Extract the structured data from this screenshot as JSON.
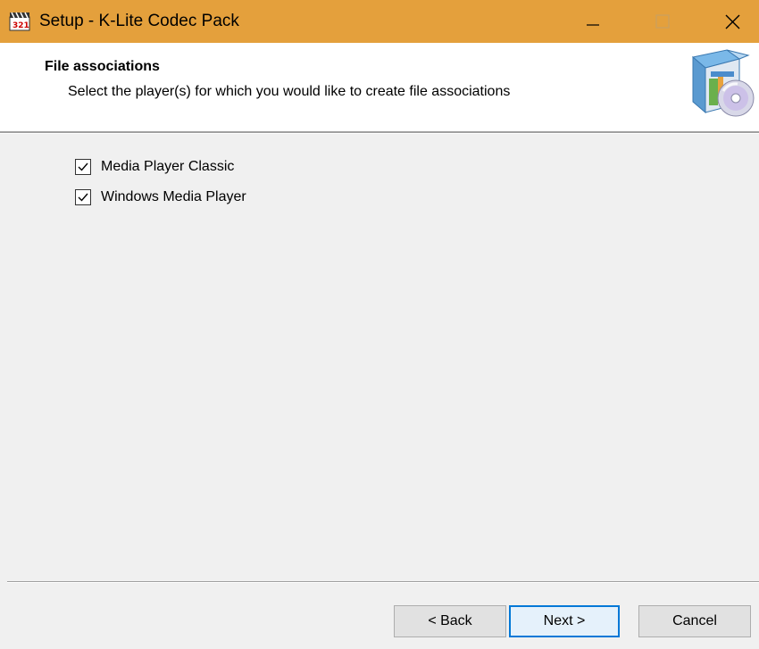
{
  "window": {
    "title": "Setup - K-Lite Codec Pack",
    "accent_color": "#e4a03c"
  },
  "titlebar_controls": {
    "minimize_icon": "minimize-icon",
    "maximize_icon": "maximize-icon",
    "close_icon": "close-icon"
  },
  "header": {
    "title": "File associations",
    "subtitle": "Select the player(s) for which you would like to create file associations",
    "logo_icon": "installer-box-cd-icon"
  },
  "players": [
    {
      "label": "Media Player Classic",
      "checked": true
    },
    {
      "label": "Windows Media Player",
      "checked": true
    }
  ],
  "buttons": {
    "back": "< Back",
    "next": "Next >",
    "cancel": "Cancel"
  }
}
